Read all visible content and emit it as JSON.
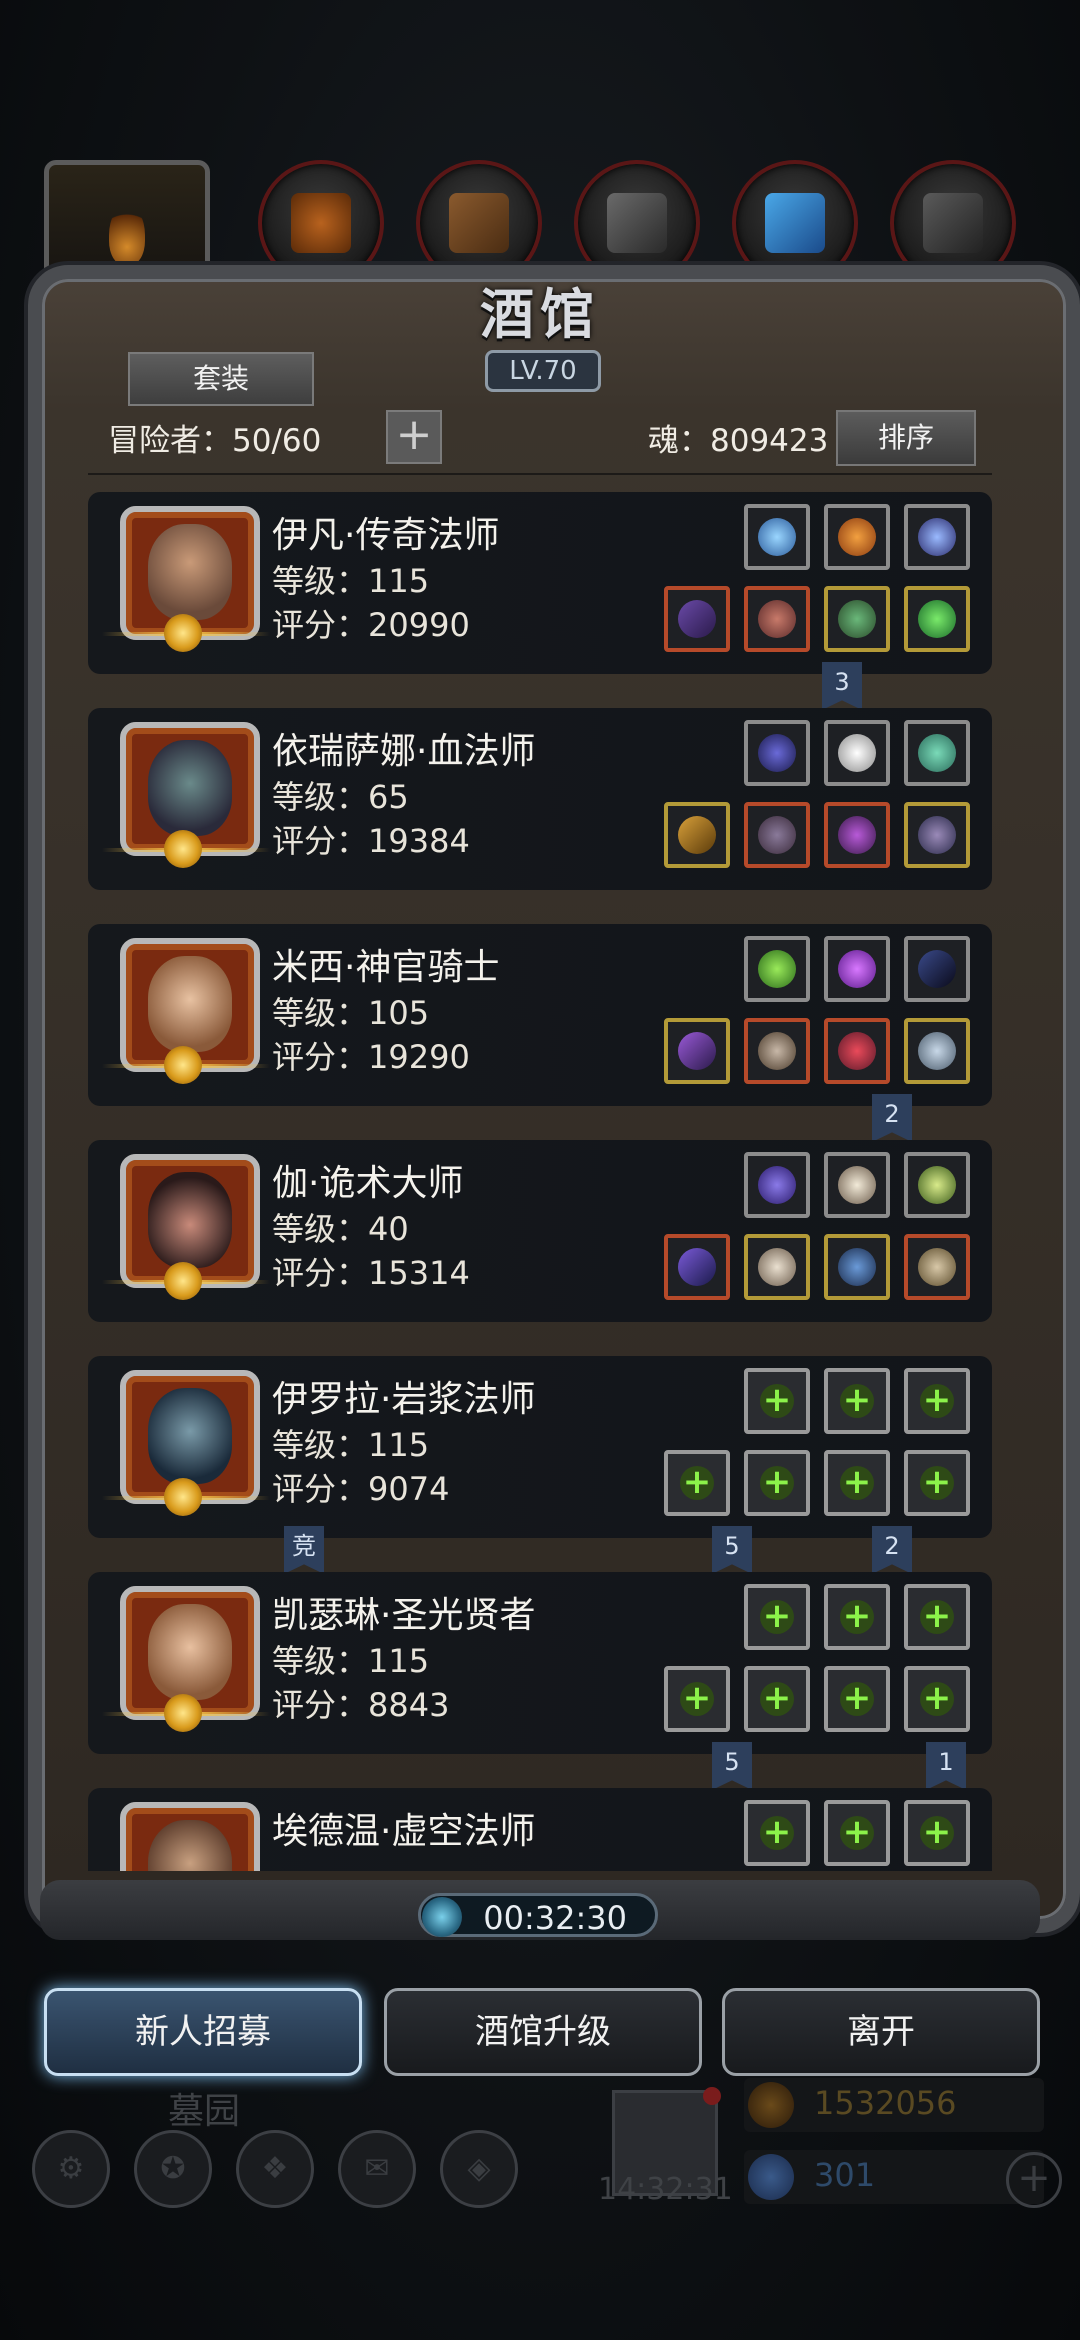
{
  "tavern": {
    "title": "酒馆",
    "level": "LV.70",
    "set_button": "套装",
    "adventurers_label": "冒险者：50/60",
    "plus_label": "+",
    "soul_label": "魂：809423",
    "sort_button": "排序"
  },
  "heroes": [
    {
      "name": "伊凡·传奇法师",
      "level": "等级：115",
      "score": "评分：20990",
      "slots": "equipped",
      "ribbons": [
        "3"
      ]
    },
    {
      "name": "依瑞萨娜·血法师",
      "level": "等级：65",
      "score": "评分：19384",
      "slots": "equipped",
      "ribbons": []
    },
    {
      "name": "米西·神官骑士",
      "level": "等级：105",
      "score": "评分：19290",
      "slots": "equipped",
      "ribbons": [
        "2"
      ]
    },
    {
      "name": "伽·诡术大师",
      "level": "等级：40",
      "score": "评分：15314",
      "slots": "equipped",
      "ribbons": []
    },
    {
      "name": "伊罗拉·岩浆法师",
      "level": "等级：115",
      "score": "评分：9074",
      "slots": "empty",
      "ribbons": [
        "竞",
        "5",
        "2"
      ]
    },
    {
      "name": "凯瑟琳·圣光贤者",
      "level": "等级：115",
      "score": "评分：8843",
      "slots": "empty",
      "ribbons": [
        "5",
        "1"
      ]
    },
    {
      "name": "埃德温·虚空法师",
      "level": "",
      "score": "",
      "slots": "empty",
      "ribbons": []
    }
  ],
  "timer": "00:32:30",
  "actions": {
    "recruit": "新人招募",
    "upgrade": "酒馆升级",
    "leave": "离开"
  },
  "background_hud": {
    "location": "墓园",
    "clock": "14:32:31",
    "gold": "1532056",
    "gems": "301"
  },
  "colors": {
    "accent_blue": "#7ab8e8",
    "add_green": "#8cf24a",
    "frame_grey": "#4a4c50"
  },
  "icons": [
    "plus-icon",
    "timer-icon",
    "medal-icon",
    "gold-icon",
    "gem-icon",
    "gift-icon",
    "settings-icon"
  ]
}
